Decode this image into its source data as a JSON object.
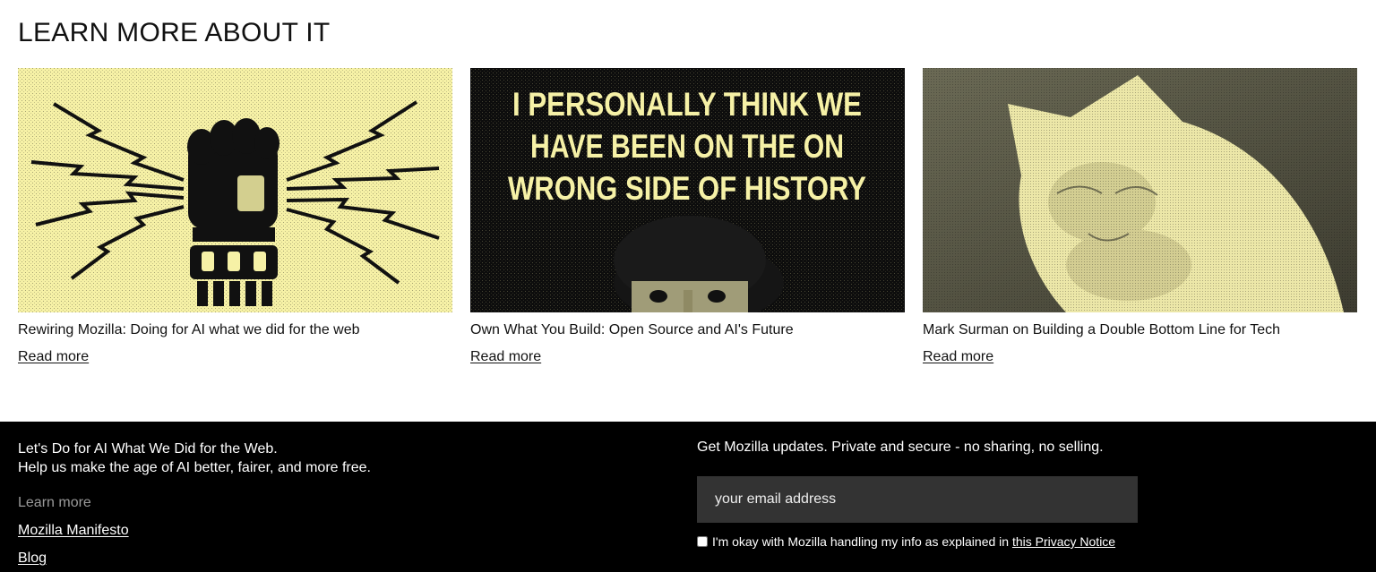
{
  "section": {
    "title": "LEARN MORE ABOUT IT"
  },
  "cards": [
    {
      "title": "Rewiring Mozilla: Doing for AI what we did for the web",
      "link": "Read more",
      "image": "raised-fist-lightning-illustration"
    },
    {
      "title": "Own What You Build: Open Source and AI's Future",
      "link": "Read more",
      "image": "quote-poster-with-portrait",
      "image_text": [
        "I PERSONALLY THINK WE",
        "HAVE BEEN ON THE ON",
        "WRONG SIDE OF HISTORY"
      ]
    },
    {
      "title": "Mark Surman on Building a Double Bottom Line for Tech",
      "link": "Read more",
      "image": "cat-photo-dithered"
    }
  ],
  "footer": {
    "tagline_line1": "Let's Do for AI What We Did for the Web.",
    "tagline_line2": "Help us make the age of AI better, fairer, and more free.",
    "learn_more": "Learn more",
    "links": {
      "manifesto": "Mozilla Manifesto",
      "blog": "Blog"
    },
    "newsletter": {
      "heading": "Get Mozilla updates. Private and secure - no sharing, no selling.",
      "placeholder": "your email address",
      "consent_text": "I'm okay with Mozilla handling my info as explained in ",
      "consent_link": "this Privacy Notice"
    }
  },
  "colors": {
    "cream": "#f6f1a6",
    "ink": "#111111",
    "footer_bg": "#000000",
    "input_bg": "#333333"
  }
}
